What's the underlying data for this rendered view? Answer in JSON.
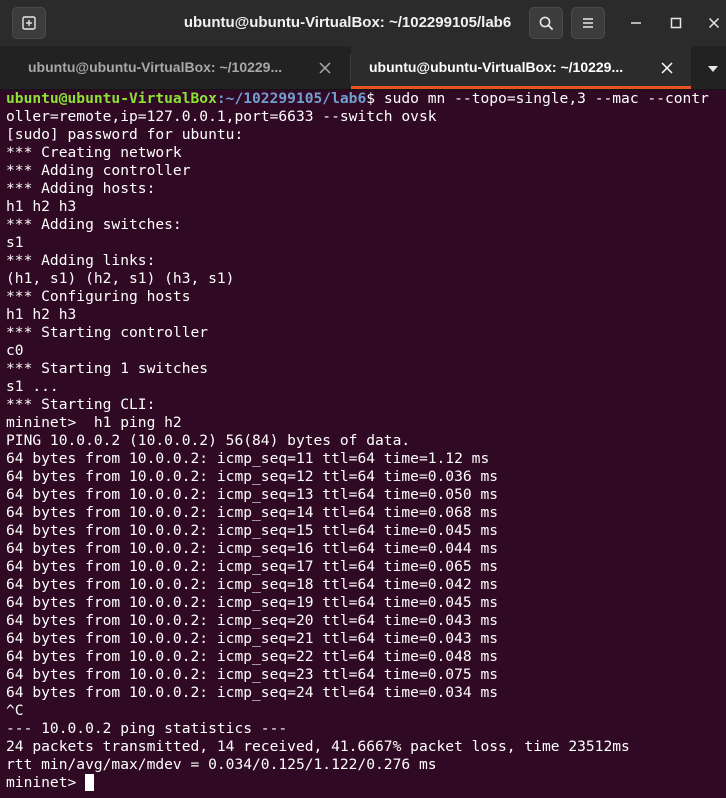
{
  "window": {
    "title": "ubuntu@ubuntu-VirtualBox: ~/102299105/lab6"
  },
  "icons": {
    "new_tab": "new-tab-icon",
    "search": "search-icon",
    "menu": "hamburger-menu-icon",
    "minimize": "minimize-icon",
    "maximize": "maximize-icon",
    "close": "close-icon",
    "tab_close": "close-icon",
    "tabs_menu": "chevron-down-icon"
  },
  "colors": {
    "background": "#300a24",
    "prompt_user": "#8ae234",
    "prompt_path": "#729fcf",
    "active_tab_accent": "#e95420"
  },
  "tabs": [
    {
      "label": "ubuntu@ubuntu-VirtualBox: ~/10229...",
      "active": false
    },
    {
      "label": "ubuntu@ubuntu-VirtualBox: ~/10229...",
      "active": true
    }
  ],
  "terminal": {
    "prompt": {
      "user_host": "ubuntu@ubuntu-VirtualBox",
      "path": ":~/102299105/lab6",
      "symbol": "$ ",
      "command": "sudo mn --topo=single,3 --mac --contr"
    },
    "lines": [
      "oller=remote,ip=127.0.0.1,port=6633 --switch ovsk",
      "[sudo] password for ubuntu:",
      "*** Creating network",
      "*** Adding controller",
      "*** Adding hosts:",
      "h1 h2 h3",
      "*** Adding switches:",
      "s1",
      "*** Adding links:",
      "(h1, s1) (h2, s1) (h3, s1)",
      "*** Configuring hosts",
      "h1 h2 h3",
      "*** Starting controller",
      "c0",
      "*** Starting 1 switches",
      "s1 ...",
      "*** Starting CLI:",
      "mininet>  h1 ping h2",
      "PING 10.0.0.2 (10.0.0.2) 56(84) bytes of data.",
      "64 bytes from 10.0.0.2: icmp_seq=11 ttl=64 time=1.12 ms",
      "64 bytes from 10.0.0.2: icmp_seq=12 ttl=64 time=0.036 ms",
      "64 bytes from 10.0.0.2: icmp_seq=13 ttl=64 time=0.050 ms",
      "64 bytes from 10.0.0.2: icmp_seq=14 ttl=64 time=0.068 ms",
      "64 bytes from 10.0.0.2: icmp_seq=15 ttl=64 time=0.045 ms",
      "64 bytes from 10.0.0.2: icmp_seq=16 ttl=64 time=0.044 ms",
      "64 bytes from 10.0.0.2: icmp_seq=17 ttl=64 time=0.065 ms",
      "64 bytes from 10.0.0.2: icmp_seq=18 ttl=64 time=0.042 ms",
      "64 bytes from 10.0.0.2: icmp_seq=19 ttl=64 time=0.045 ms",
      "64 bytes from 10.0.0.2: icmp_seq=20 ttl=64 time=0.043 ms",
      "64 bytes from 10.0.0.2: icmp_seq=21 ttl=64 time=0.043 ms",
      "64 bytes from 10.0.0.2: icmp_seq=22 ttl=64 time=0.048 ms",
      "64 bytes from 10.0.0.2: icmp_seq=23 ttl=64 time=0.075 ms",
      "64 bytes from 10.0.0.2: icmp_seq=24 ttl=64 time=0.034 ms",
      "^C",
      "--- 10.0.0.2 ping statistics ---",
      "24 packets transmitted, 14 received, 41.6667% packet loss, time 23512ms",
      "rtt min/avg/max/mdev = 0.034/0.125/1.122/0.276 ms"
    ],
    "current_prompt": "mininet> "
  }
}
